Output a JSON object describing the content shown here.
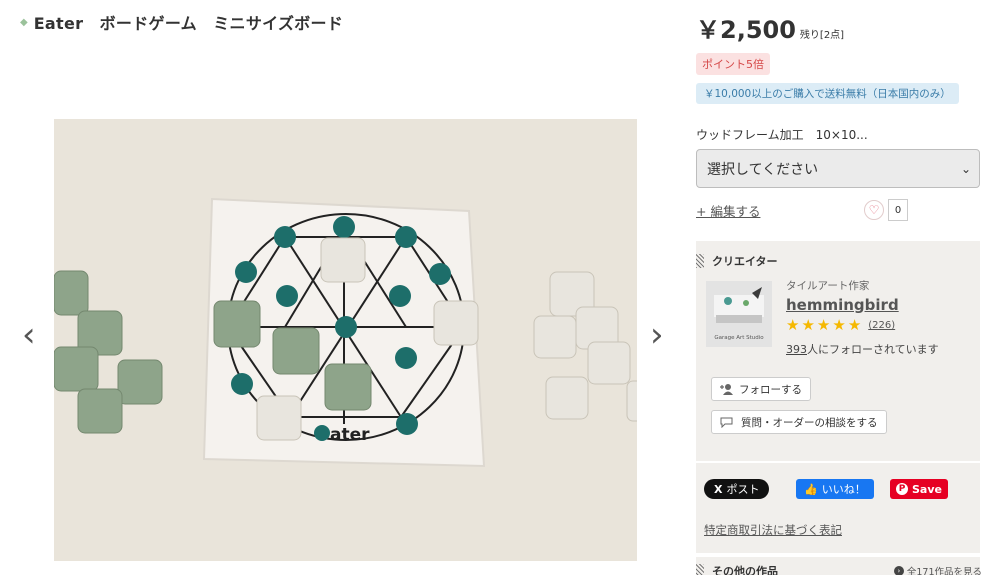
{
  "product": {
    "title": "Eater　ボードゲーム　ミニサイズボード",
    "price": "￥2,500",
    "stock": "残り[2点]",
    "point_badge": "ポイント5倍",
    "shipping_badge": "￥10,000以上のご購入で送料無料（日本国内のみ）",
    "option_label": "ウッドフレーム加工　10×10...",
    "select_value": "選択してください",
    "edit_label": "+ 編集する",
    "favorite_count": "0",
    "image_logo_text": "ater"
  },
  "creator": {
    "section_title": "クリエイター",
    "role": "タイルアート作家",
    "name": "hemmingbird",
    "rating": 5,
    "review_count": "(226)",
    "followers_num": "393",
    "followers_text": "人にフォローされています",
    "follow_label": "フォローする",
    "consult_label": "質問・オーダーの相談をする",
    "avatar_text": "Garage Art Studio"
  },
  "share": {
    "x_label": "ポスト",
    "fb_label": "いいね！",
    "pin_label": "Save",
    "law_link": "特定商取引法に基づく表記"
  },
  "other": {
    "section_title": "その他の作品",
    "see_all": "全171作品を見る"
  },
  "colors": {
    "accent_pink": "#d54848",
    "shipping_blue": "#3a7ca8",
    "star": "#f5b800",
    "panel_bg": "#f1efec"
  }
}
